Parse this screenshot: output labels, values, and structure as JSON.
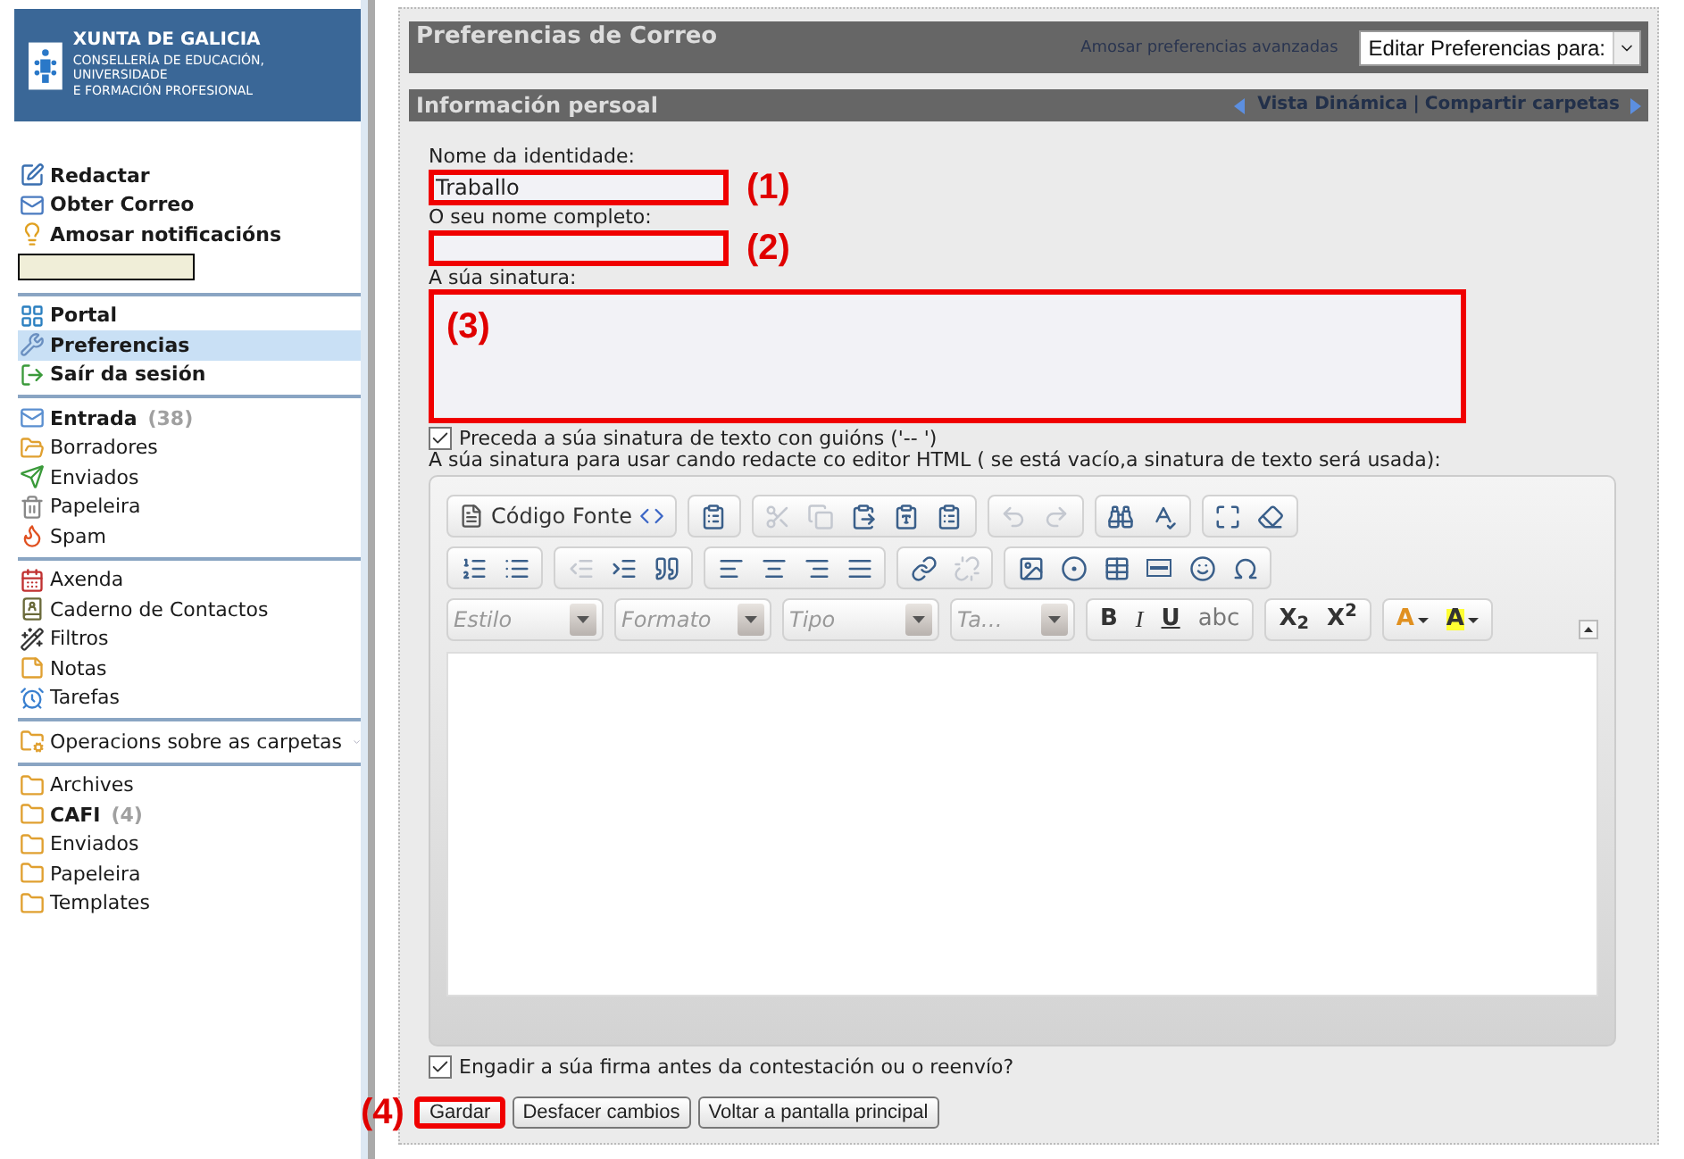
{
  "sidebar": {
    "logo": {
      "title": "XUNTA DE GALICIA",
      "subtitle": [
        "CONSELLERÍA DE EDUCACIÓN, UNIVERSIDADE",
        "E FORMACIÓN PROFESIONAL"
      ]
    },
    "sections": [
      {
        "kind": "actions",
        "items": [
          {
            "label": "Redactar",
            "selected": false
          },
          {
            "label": "Obter Correo",
            "selected": false
          },
          {
            "label": "Amosar notificacións",
            "selected": false
          }
        ],
        "field": {
          "kind": "blank"
        }
      },
      {
        "kind": "actions",
        "items": [
          {
            "label": "Portal",
            "selected": false
          },
          {
            "label": "Preferencias",
            "selected": true
          },
          {
            "label": "Saír da sesión",
            "selected": false
          }
        ]
      },
      {
        "kind": "folders",
        "items": [
          {
            "label": "Entrada",
            "count": "(38)",
            "selected": false
          },
          {
            "label": "Borradores",
            "selected": false
          },
          {
            "label": "Enviados",
            "selected": false
          },
          {
            "label": "Papeleira",
            "selected": false
          },
          {
            "label": "Spam",
            "selected": false
          }
        ]
      },
      {
        "kind": "folders",
        "items": [
          {
            "label": "Axenda",
            "selected": false
          },
          {
            "label": "Caderno de Contactos",
            "selected": false
          },
          {
            "label": "Filtros",
            "selected": false
          },
          {
            "label": "Notas",
            "selected": false
          },
          {
            "label": "Tarefas",
            "selected": false
          }
        ]
      },
      {
        "kind": "menu",
        "items": [
          {
            "label": "Operacions sobre as carpetas",
            "selected": false
          }
        ]
      },
      {
        "kind": "folders",
        "items": [
          {
            "label": "Archives",
            "selected": false
          },
          {
            "label": "CAFI",
            "count": "(4)",
            "selected": false
          },
          {
            "label": "Enviados",
            "selected": false
          },
          {
            "label": "Papeleira",
            "selected": false
          },
          {
            "label": "Templates",
            "selected": false
          }
        ]
      }
    ]
  },
  "header": {
    "title": "Preferencias de Correo",
    "link": "Amosar preferencias avanzadas",
    "select": "Editar Preferencias para:"
  },
  "section_bar": {
    "title": "Información persoal",
    "links": [
      "Vista Dinámica",
      "Compartir carpetas"
    ],
    "separator": "|"
  },
  "form": {
    "identity": {
      "label": "Nome da identidade:",
      "value": "Traballo",
      "marker": "(1)"
    },
    "full_name": {
      "label": "O seu nome completo:",
      "marker": "(2)"
    },
    "signature": {
      "label": "A súa sinatura:",
      "marker": "(3)"
    },
    "dashes": {
      "label": "Preceda a súa sinatura de texto con guións ('-- ')",
      "checked": true
    },
    "html_label": "A súa sinatura para usar cando redacte co editor HTML ( se está vacío,a sinatura de texto será usada):",
    "toolbar": [
      [
        [
          {
            "kind": "source",
            "label": "Código Fonte",
            "disabled": false
          }
        ],
        [
          {
            "kind": "icon",
            "disabled": false
          }
        ],
        [
          {
            "kind": "icon",
            "disabled": true
          },
          {
            "kind": "icon",
            "disabled": true
          },
          {
            "kind": "icon",
            "disabled": false
          },
          {
            "kind": "icon",
            "disabled": false
          },
          {
            "kind": "icon",
            "disabled": false
          }
        ],
        [
          {
            "kind": "icon",
            "disabled": true
          },
          {
            "kind": "icon",
            "disabled": true
          }
        ],
        [
          {
            "kind": "icon",
            "disabled": false
          },
          {
            "kind": "icon",
            "disabled": false
          }
        ],
        [
          {
            "kind": "icon",
            "disabled": false
          },
          {
            "kind": "icon",
            "disabled": false
          }
        ]
      ],
      [
        [
          {
            "kind": "icon",
            "disabled": false
          },
          {
            "kind": "icon",
            "disabled": false
          }
        ],
        [
          {
            "kind": "icon",
            "disabled": true
          },
          {
            "kind": "icon",
            "disabled": false
          },
          {
            "kind": "icon",
            "disabled": false
          }
        ],
        [
          {
            "kind": "icon",
            "disabled": false
          },
          {
            "kind": "icon",
            "disabled": false
          },
          {
            "kind": "icon",
            "disabled": false
          },
          {
            "kind": "icon",
            "disabled": false
          }
        ],
        [
          {
            "kind": "icon",
            "disabled": false
          },
          {
            "kind": "icon",
            "disabled": true
          }
        ],
        [
          {
            "kind": "icon",
            "disabled": false
          },
          {
            "kind": "icon",
            "disabled": false
          },
          {
            "kind": "icon",
            "disabled": false
          },
          {
            "kind": "icon",
            "disabled": false
          },
          {
            "kind": "icon",
            "disabled": false
          },
          {
            "kind": "icon",
            "disabled": false
          }
        ]
      ],
      [
        [
          {
            "kind": "combo",
            "placeholder": "Estilo"
          }
        ],
        [
          {
            "kind": "combo",
            "placeholder": "Formato"
          }
        ],
        [
          {
            "kind": "combo",
            "placeholder": "Tipo"
          }
        ],
        [
          {
            "kind": "combo",
            "placeholder": "Ta…"
          }
        ],
        [
          {
            "kind": "bold",
            "label": "B"
          },
          {
            "kind": "italic",
            "label": "I"
          },
          {
            "kind": "underline",
            "label": "U"
          },
          {
            "kind": "strike",
            "label": "abc"
          }
        ],
        [
          {
            "kind": "script",
            "label": "X$_{2}$"
          },
          {
            "kind": "script",
            "label": "X$^{2}$"
          }
        ],
        [
          {
            "kind": "textcolor",
            "label": "A"
          },
          {
            "kind": "bgcolor",
            "label": "A",
            "color": "#ffff33"
          }
        ]
      ]
    ],
    "append": {
      "label": "Engadir a súa firma antes da contestación ou o reenvío?",
      "checked": true
    },
    "buttons": [
      {
        "label": "Gardar",
        "marker": "(4)"
      },
      {
        "label": "Desfacer cambios"
      },
      {
        "label": "Voltar a pantalla principal"
      }
    ]
  }
}
